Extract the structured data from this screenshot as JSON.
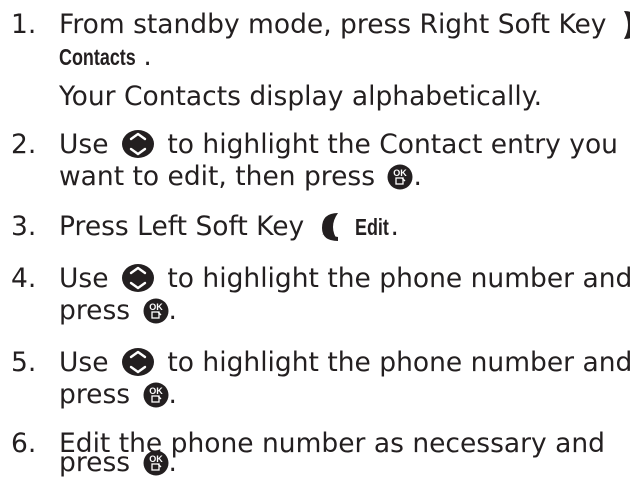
{
  "steps": [
    {
      "number": "1.",
      "line1_text": "From standby mode, press Right Soft Key",
      "line2_bold": "Contacts",
      "line2_after": ".",
      "line3_text": "Your Contacts display alphabetically.",
      "icons": [
        "right-soft-key-icon"
      ]
    },
    {
      "number": "2.",
      "line1_before": "Use",
      "line1_after": "to highlight the Contact entry you",
      "line2_before": "want to edit, then press",
      "line2_after": ".",
      "icons": [
        "navigation-key-icon",
        "ok-key-icon"
      ]
    },
    {
      "number": "3.",
      "line1_before": "Press Left Soft Key",
      "line1_bold": "Edit",
      "line1_after": ".",
      "icons": [
        "left-soft-key-icon"
      ]
    },
    {
      "number": "4.",
      "line1_before": "Use",
      "line1_after": "to highlight the phone number and",
      "line2_before": "press",
      "line2_after": ".",
      "icons": [
        "navigation-key-icon",
        "ok-key-icon"
      ]
    },
    {
      "number": "5.",
      "line1_before": "Use",
      "line1_after": "to highlight the phone number and",
      "line2_before": "press",
      "line2_after": ".",
      "icons": [
        "navigation-key-icon",
        "ok-key-icon"
      ]
    },
    {
      "number": "6.",
      "line1_text": "Edit the phone number as necessary and",
      "line2_before": "press",
      "line2_after": ".",
      "icons": [
        "ok-key-icon"
      ]
    }
  ],
  "ok_key_label": "OK",
  "colors": {
    "text": "#231f20",
    "icon_dark": "#231f20",
    "icon_light": "#ffffff"
  }
}
